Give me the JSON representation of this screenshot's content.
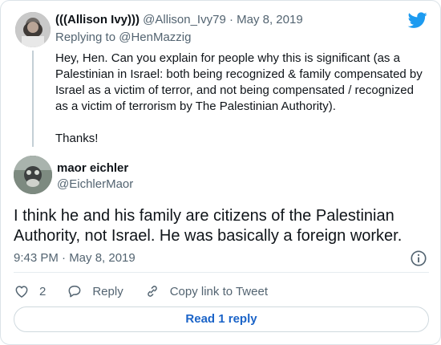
{
  "colors": {
    "twitter_blue": "#1d9bf0",
    "link_blue": "#1b64c8",
    "secondary_text": "#536471",
    "primary_text": "#0f1419"
  },
  "icons": [
    "twitter-bird-icon",
    "info-icon",
    "heart-icon",
    "reply-bubble-icon",
    "link-icon"
  ],
  "parent_tweet": {
    "display_name": "(((Allison Ivy)))",
    "handle_date": "@Allison_Ivy79 · May 8, 2019",
    "replying_prefix": "Replying to ",
    "replying_to": "@HenMazzig",
    "body": "Hey, Hen. Can you explain for people why this is significant (as a Palestinian in Israel: both being recognized & family compensated by Israel as a victim of terror, and not being compensated / recognized as a victim of terrorism by The Palestinian Authority).",
    "body_2": "Thanks!"
  },
  "tweet": {
    "display_name": "maor eichler",
    "handle": "@EichlerMaor",
    "text": "I think he and his family are citizens of the Palestinian Authority, not Israel. He was basically a foreign worker.",
    "timestamp": "9:43 PM · May 8, 2019"
  },
  "actions": {
    "like_count": "2",
    "reply_label": "Reply",
    "copy_link_label": "Copy link to Tweet"
  },
  "read_replies_label": "Read 1 reply"
}
